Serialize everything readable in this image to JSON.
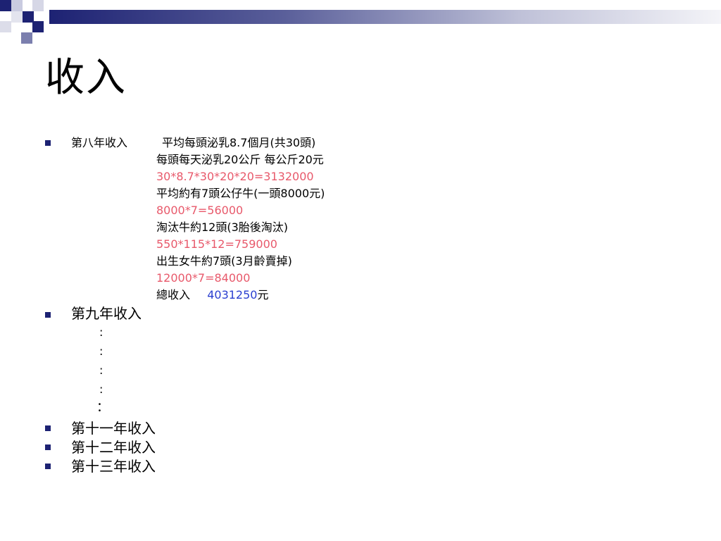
{
  "slide": {
    "title": "收入",
    "accent_color": "#1d2273",
    "calc_color": "#e8596b",
    "total_color": "#2a3fd0"
  },
  "year8": {
    "label": "第八年收入",
    "lines": [
      "平均每頭泌乳8.7個月(共30頭)",
      "每頭每天泌乳20公斤 每公斤20元",
      "30*8.7*30*20*20=3132000",
      "平均約有7頭公仔牛(一頭8000元)",
      "8000*7=56000",
      "淘汰牛約12頭(3胎後淘汰)",
      "550*115*12=759000",
      "出生女牛約7頭(3月齡賣掉)",
      "12000*7=84000"
    ],
    "total_label": "總收入",
    "total_value": "4031250",
    "total_unit": "元"
  },
  "year9": {
    "label": "第九年收入",
    "colons": [
      ":",
      ":",
      ":",
      ":",
      "："
    ]
  },
  "year11": {
    "label": "第十一年收入"
  },
  "year12": {
    "label": "第十二年收入"
  },
  "year13": {
    "label": "第十三年收入"
  }
}
